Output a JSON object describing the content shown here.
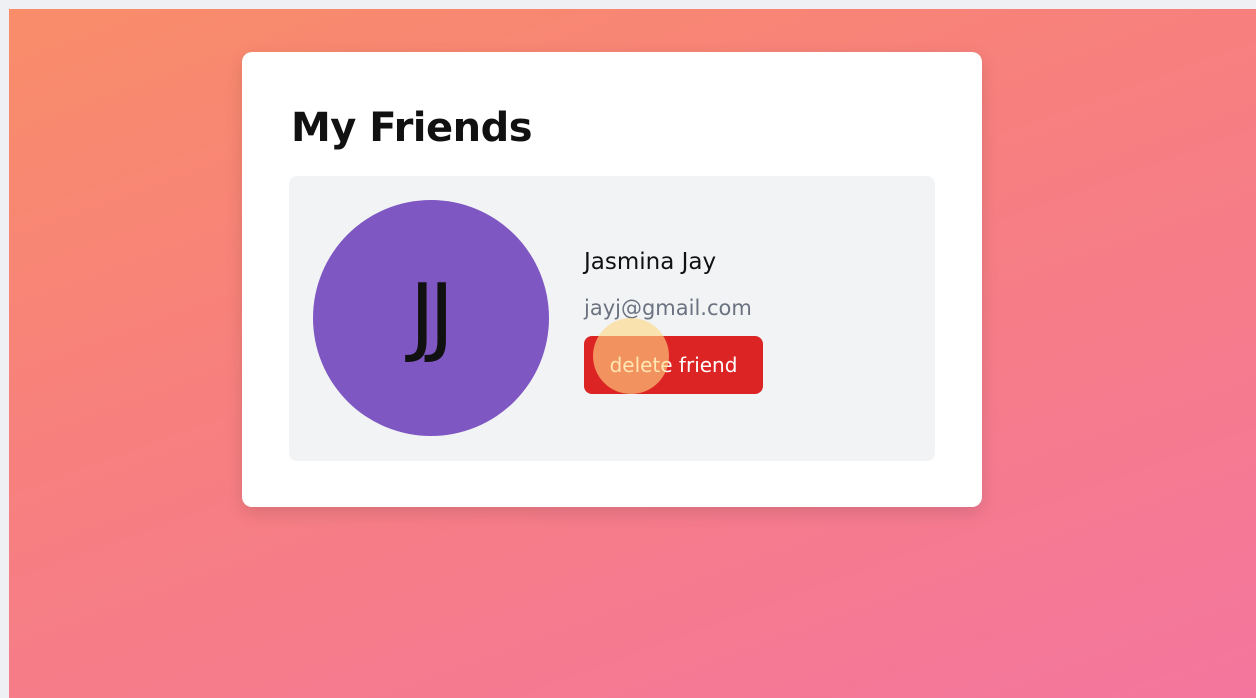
{
  "page": {
    "title": "My Friends"
  },
  "friends": [
    {
      "initials": "JJ",
      "name": "Jasmina Jay",
      "email": "jayj@gmail.com",
      "delete_label": "delete friend"
    }
  ],
  "colors": {
    "background_start": "#f98d69",
    "background_end": "#f4769e",
    "card": "#ffffff",
    "row": "#f2f3f5",
    "avatar": "#7e57c2",
    "delete_button": "#dc2424",
    "email_text": "#6b7280",
    "click_indicator": "#ffd682"
  }
}
